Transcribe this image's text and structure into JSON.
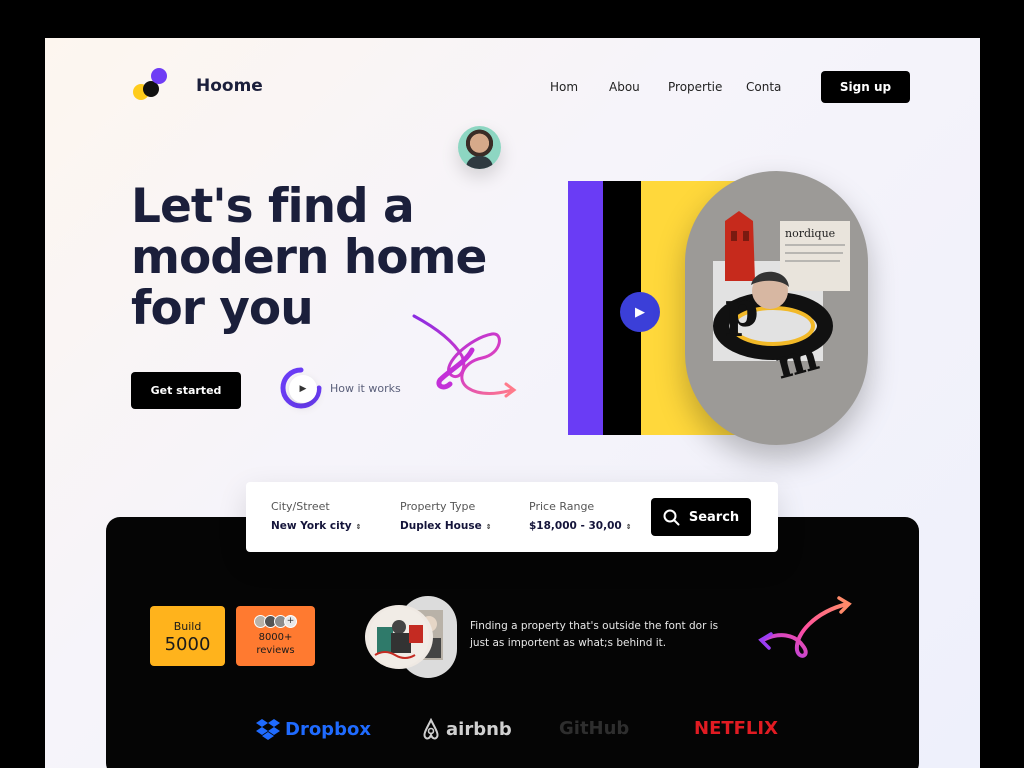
{
  "brand": {
    "name": "Hoome"
  },
  "nav": {
    "items": [
      "Hom",
      "Abou",
      "Propertie",
      "Conta"
    ],
    "signup_label": "Sign up"
  },
  "hero": {
    "title_lines": [
      "Let's find a",
      "modern home",
      "for you"
    ],
    "cta_label": "Get started",
    "how_label": "How it works"
  },
  "search": {
    "fields": [
      {
        "label": "City/Street",
        "value": "New York city"
      },
      {
        "label": "Property Type",
        "value": "Duplex House"
      },
      {
        "label": "Price Range",
        "value": "$18,000 - 30,00"
      }
    ],
    "button_label": "Search"
  },
  "stats": {
    "build_label": "Build",
    "build_value": "5000",
    "reviews_value": "8000+",
    "reviews_label": "reviews"
  },
  "quote": "Finding a property that's outside the font dor is just as importent as what;s behind it.",
  "partners": [
    "Dropbox",
    "airbnb",
    "GitHub",
    "NETFLIX"
  ],
  "colors": {
    "purple": "#6a3cf5",
    "yellow": "#ffd83b",
    "orange": "#ff7a30",
    "amber": "#ffb31c",
    "play_blue": "#3b3fd8"
  }
}
